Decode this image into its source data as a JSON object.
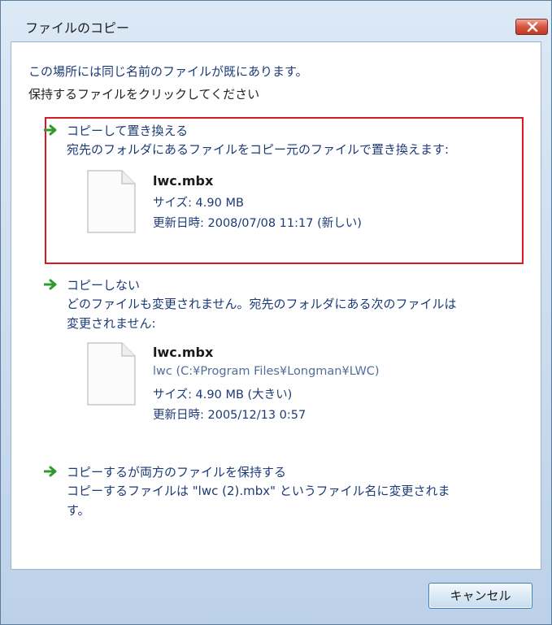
{
  "window": {
    "title": "ファイルのコピー"
  },
  "intro": {
    "line1": "この場所には同じ名前のファイルが既にあります。",
    "line2": "保持するファイルをクリックしてください"
  },
  "options": [
    {
      "title": "コピーして置き換える",
      "description": "宛先のフォルダにあるファイルをコピー元のファイルで置き換えます:",
      "file": {
        "name": "lwc.mbx",
        "size": "サイズ: 4.90 MB",
        "modified": "更新日時: 2008/07/08 11:17 (新しい)"
      },
      "selected": true
    },
    {
      "title": "コピーしない",
      "description_line1": "どのファイルも変更されません。宛先のフォルダにある次のファイルは",
      "description_line2": "変更されません:",
      "file": {
        "name": "lwc.mbx",
        "path": "lwc (C:¥Program Files¥Longman¥LWC)",
        "size": "サイズ: 4.90 MB (大きい)",
        "modified": "更新日時: 2005/12/13 0:57"
      }
    },
    {
      "title": "コピーするが両方のファイルを保持する",
      "description_line1": "コピーするファイルは \"lwc (2).mbx\" というファイル名に変更されま",
      "description_line2": "す。"
    }
  ],
  "footer": {
    "cancel_label": "キャンセル"
  },
  "colors": {
    "selection_border": "#d71920",
    "arrow_green": "#2e9a2e",
    "link_blue": "#1c3a78"
  },
  "icons": {
    "close": "close-icon",
    "arrow": "green-arrow-icon",
    "file": "document-icon"
  }
}
